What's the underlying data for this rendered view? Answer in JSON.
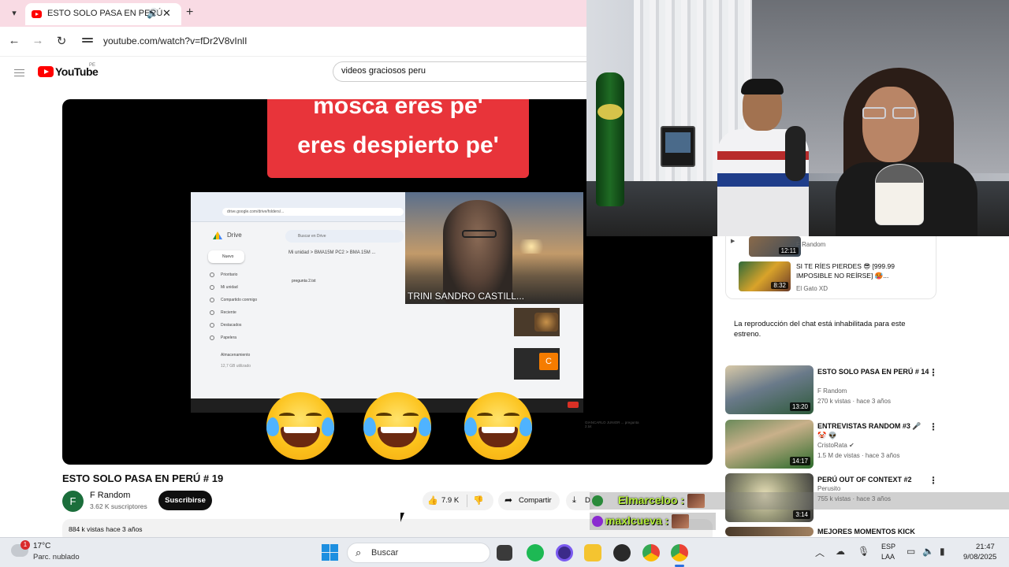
{
  "browser": {
    "tab_title": "ESTO SOLO PASA EN PERÚ",
    "url": "youtube.com/watch?v=fDr2V8vInlI"
  },
  "youtube": {
    "logo_text": "YouTube",
    "country": "PE",
    "search_value": "videos graciosos peru"
  },
  "video": {
    "caption_line1": "mosca eres pe'",
    "caption_line2": "eres despierto pe'",
    "inner_url": "drive.google.com/drive/folders/...",
    "drive_name": "Drive",
    "drive_new": "Nuevo",
    "drive_items": [
      "Prioritario",
      "Mi unidad",
      "Compartido conmigo",
      "Reciente",
      "Destacados",
      "Papelera",
      "Almacenamiento",
      "12,7 GB utilizado"
    ],
    "drive_search": "Buscar en Drive",
    "drive_path": "Mi unidad  >  BMA15M PC2  >  BMA 15M ...",
    "drive_file": "pregunta 2.txt",
    "side_note": "GIANCARLO JUNIOR ...  pregunta 2.txt",
    "cam_label": "TRINI SANDRO CASTILL...",
    "participant_letter": "C",
    "title": "ESTO SOLO PASA EN PERÚ # 19",
    "channel_initial": "F",
    "channel_name": "F Random",
    "channel_subs": "3.62 K suscriptores",
    "subscribe_label": "Suscribirse",
    "likes": "7.9 K",
    "share_label": "Compartir",
    "download_label": "D",
    "stats": "884 k vistas  hace 3 años"
  },
  "sidebar": {
    "top_items": [
      {
        "duration": "12:11",
        "title": "",
        "channel": "F Random"
      },
      {
        "duration": "8:32",
        "title": "SI TE RÍES PIERDES 😎 [999.99 IMPOSIBLE NO REÍRSE] 🥵...",
        "channel": "El Gato XD"
      }
    ],
    "chat_disabled": "La reproducción del chat está inhabilitada para este estreno.",
    "recommendations": [
      {
        "title": "ESTO SOLO PASA EN PERÚ # 14",
        "channel": "F Random",
        "meta": "270 k vistas · hace 3 años",
        "duration": "13:20"
      },
      {
        "title": "ENTREVISTAS RANDOM #3 🎤 🤡 👽",
        "channel": "CristoRata ✔",
        "meta": "1.5 M de vistas · hace 3 años",
        "duration": "14:17"
      },
      {
        "title": "PERÚ OUT OF CONTEXT #2",
        "channel": "Perusito",
        "meta": "755 k vistas · hace 3 años",
        "duration": "3:14"
      },
      {
        "title": "MEJORES MOMENTOS KICK",
        "channel": "",
        "meta": "",
        "duration": ""
      }
    ]
  },
  "chat_overlay": {
    "messages": [
      {
        "user": "Elmarceloo :"
      },
      {
        "user": "maxlcueva :"
      }
    ]
  },
  "taskbar": {
    "weather_badge": "1",
    "temperature": "17°C",
    "weather_desc": "Parc. nublado",
    "search_placeholder": "Buscar",
    "lang1": "ESP",
    "lang2": "LAA",
    "time": "21:47",
    "date": "9/08/2025"
  },
  "colors": {
    "youtube_red": "#ff0000",
    "caption_red": "#e8343a",
    "chat_name_green": "#b5f03a",
    "tab_bar_pink": "#f9dbe4"
  }
}
